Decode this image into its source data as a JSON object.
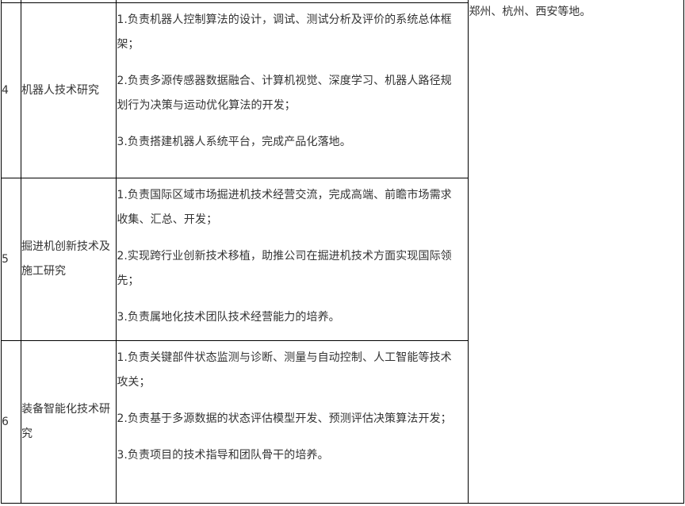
{
  "rows": [
    {
      "num": "4",
      "name": "机器人技术研究",
      "duties": [
        "1.负责机器人控制算法的设计，调试、测试分析及评价的系统总体框架；",
        "2.负责多源传感器数据融合、计算机视觉、深度学习、机器人路径规划行为决策与运动优化算法的开发；",
        "3.负责搭建机器人系统平台，完成产品化落地。"
      ]
    },
    {
      "num": "5",
      "name": "掘进机创新技术及施工研究",
      "duties": [
        "1.负责国际区域市场掘进机技术经营交流，完成高端、前瞻市场需求收集、汇总、开发；",
        "2.实现跨行业创新技术移植，助推公司在掘进机技术方面实现国际领先；",
        "3.负责属地化技术团队技术经营能力的培养。"
      ]
    },
    {
      "num": "6",
      "name": "装备智能化技术研究",
      "duties": [
        "1.负责关键部件状态监测与诊断、测量与自动控制、人工智能等技术攻关；",
        "2.负责基于多源数据的状态评估模型开发、预测评估决策算法开发；",
        "3.负责项目的技术指导和团队骨干的培养。"
      ]
    }
  ],
  "location": "郑州、杭州、西安等地。"
}
